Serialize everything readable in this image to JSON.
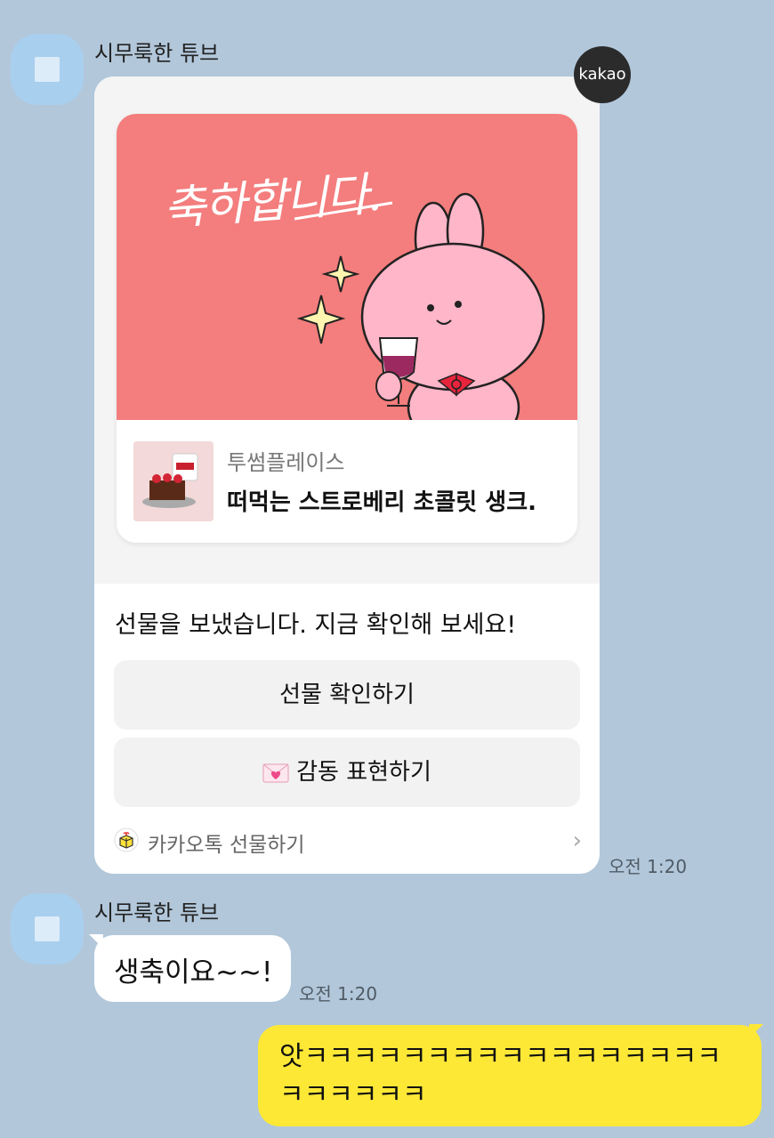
{
  "messages": {
    "gift": {
      "sender": "시무룩한 튜브",
      "badge": "kakao",
      "banner_title": "축하합니다.",
      "brand": "투썸플레이스",
      "product_name": "떠먹는 스트로베리 초콜릿 생크.",
      "message": "선물을 보냈습니다. 지금 확인해 보세요!",
      "check_button": "선물 확인하기",
      "thanks_button": "감동 표현하기",
      "thanks_icon": "envelope-heart-icon",
      "footer_label": "카카오톡 선물하기",
      "footer_icon": "gift-box-icon",
      "time": "오전 1:20"
    },
    "reply": {
      "sender": "시무룩한 튜브",
      "text": "생축이요~~!",
      "time": "오전 1:20"
    },
    "mine": {
      "text": "앗ㅋㅋㅋㅋㅋㅋㅋㅋㅋㅋㅋㅋㅋㅋㅋㅋㅋㅋㅋㅋㅋㅋㅋ"
    }
  },
  "colors": {
    "background": "#b2c7da",
    "my_bubble": "#fde836",
    "banner": "#f47d7d",
    "avatar": "#a9cfee"
  }
}
